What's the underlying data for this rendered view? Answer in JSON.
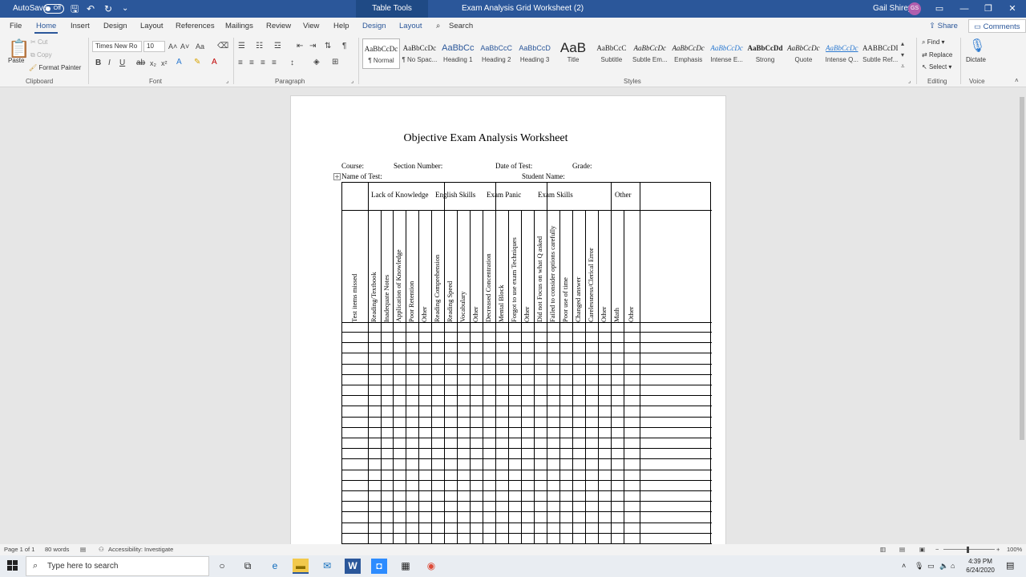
{
  "titlebar": {
    "autosave_label": "AutoSave",
    "autosave_state": "Off",
    "context_tab": "Table Tools",
    "doc_title": "Exam Analysis Grid Worksheet (2)",
    "user_name": "Gail Shirey",
    "user_initials": "GS"
  },
  "tabs": [
    "File",
    "Home",
    "Insert",
    "Design",
    "Layout",
    "References",
    "Mailings",
    "Review",
    "View",
    "Help",
    "Design",
    "Layout"
  ],
  "search_label": "Search",
  "share_label": "Share",
  "comments_label": "Comments",
  "ribbon": {
    "clipboard": {
      "paste": "Paste",
      "cut": "Cut",
      "copy": "Copy",
      "format_painter": "Format Painter",
      "group": "Clipboard"
    },
    "font": {
      "family": "Times New Ro",
      "size": "10",
      "group": "Font"
    },
    "paragraph": {
      "group": "Paragraph"
    },
    "styles": {
      "group": "Styles",
      "items": [
        {
          "preview": "AaBbCcDc",
          "name": "¶ Normal"
        },
        {
          "preview": "AaBbCcDc",
          "name": "¶ No Spac..."
        },
        {
          "preview": "AaBbCc",
          "name": "Heading 1"
        },
        {
          "preview": "AaBbCcC",
          "name": "Heading 2"
        },
        {
          "preview": "AaBbCcD",
          "name": "Heading 3"
        },
        {
          "preview": "AaB",
          "name": "Title"
        },
        {
          "preview": "AaBbCcC",
          "name": "Subtitle"
        },
        {
          "preview": "AaBbCcDc",
          "name": "Subtle Em..."
        },
        {
          "preview": "AaBbCcDc",
          "name": "Emphasis"
        },
        {
          "preview": "AaBbCcDc",
          "name": "Intense E..."
        },
        {
          "preview": "AaBbCcDd",
          "name": "Strong"
        },
        {
          "preview": "AaBbCcDc",
          "name": "Quote"
        },
        {
          "preview": "AaBbCcDc",
          "name": "Intense Q..."
        },
        {
          "preview": "AABBCcDI",
          "name": "Subtle Ref..."
        }
      ]
    },
    "editing": {
      "find": "Find",
      "replace": "Replace",
      "select": "Select",
      "group": "Editing"
    },
    "voice": {
      "dictate": "Dictate",
      "group": "Voice"
    }
  },
  "document": {
    "title": "Objective Exam Analysis Worksheet",
    "fields": {
      "course": "Course:",
      "section": "Section Number:",
      "date": "Date of Test:",
      "grade": "Grade:",
      "test_name": "Name of Test:",
      "student": "Student Name:"
    },
    "categories": [
      {
        "label": "Lack of Knowledge"
      },
      {
        "label": "English Skills"
      },
      {
        "label": "Exam Panic"
      },
      {
        "label": "Exam Skills"
      },
      {
        "label": "Other"
      }
    ],
    "columns": [
      "Test items missed",
      "Reading/Textbook",
      "Inadequate Notes",
      "Application of Knowledge",
      "Poor Retention",
      "Other",
      "Reading Comprehension",
      "Reading Speed",
      "Vocabulary",
      "Other",
      "Decreased Concentration",
      "Mental Block",
      "Forgot to use exam Techniques",
      "Other",
      "Did not Focus on what Q asked",
      "Failed to consider options carefully",
      "Poor use of time",
      "Changed answer",
      "Carelessness/Clerical Error",
      "Other",
      "Math",
      "Other"
    ]
  },
  "statusbar": {
    "page": "Page 1 of 1",
    "words": "80 words",
    "accessibility": "Accessibility: Investigate",
    "zoom": "100%"
  },
  "taskbar": {
    "search_placeholder": "Type here to search",
    "time": "4:39 PM",
    "date": "6/24/2020"
  }
}
